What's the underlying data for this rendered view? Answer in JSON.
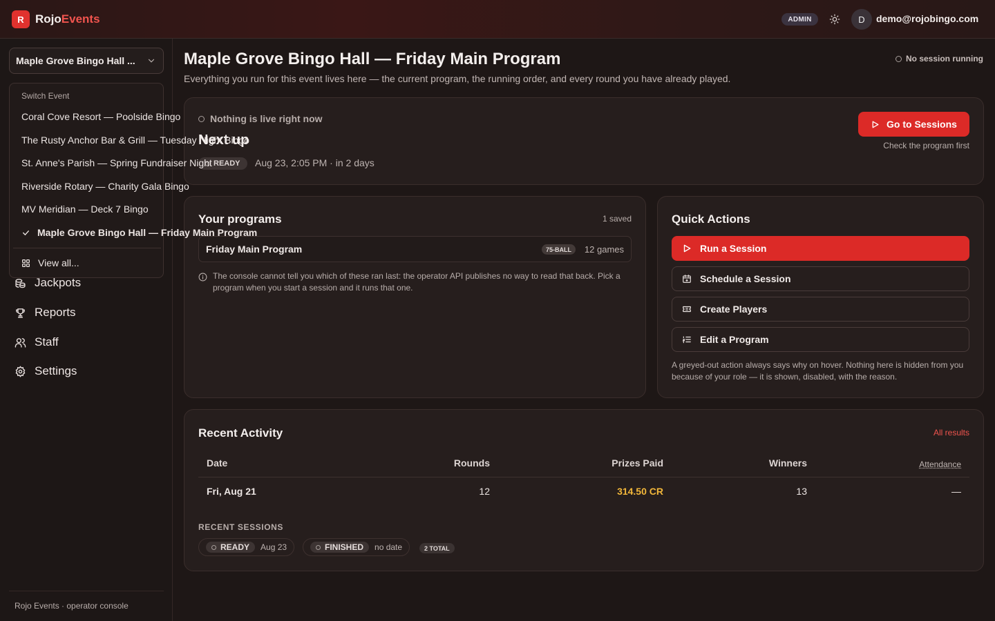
{
  "app": {
    "logo_letter": "R",
    "brand_part1": "Rojo",
    "brand_part2": "Events",
    "role_badge": "ADMIN",
    "user_initial": "D",
    "user_email": "demo@rojobingo.com"
  },
  "sidebar": {
    "selected_event": "Maple Grove Bingo Hall ...",
    "nav": [
      {
        "label": "Jackpots",
        "icon": "coins-icon"
      },
      {
        "label": "Reports",
        "icon": "trophy-icon"
      },
      {
        "label": "Staff",
        "icon": "users-icon"
      },
      {
        "label": "Settings",
        "icon": "gear-icon"
      }
    ],
    "footer": "Rojo Events · operator console"
  },
  "event_dropdown": {
    "header": "Switch Event",
    "items": [
      "Coral Cove Resort — Poolside Bingo",
      "The Rusty Anchor Bar & Grill — Tuesday Night Bingo",
      "St. Anne's Parish — Spring Fundraiser Night",
      "Riverside Rotary — Charity Gala Bingo",
      "MV Meridian — Deck 7 Bingo",
      "Maple Grove Bingo Hall — Friday Main Program"
    ],
    "view_all": "View all..."
  },
  "page": {
    "title": "Maple Grove Bingo Hall — Friday Main Program",
    "subtitle": "Everything you run for this event lives here — the current program, the running order, and every round you have already played.",
    "session_status": "No session running"
  },
  "next_up": {
    "live_status": "Nothing is live right now",
    "heading": "Next up",
    "status_pill": "READY",
    "when": "Aug 23, 2:05 PM · in 2 days",
    "button": "Go to Sessions",
    "hint": "Check the program first"
  },
  "programs": {
    "title": "Your programs",
    "saved_count": "1 saved",
    "items": [
      {
        "name": "Friday Main Program",
        "badge": "75-BALL",
        "games": "12 games"
      }
    ],
    "note": "The console cannot tell you which of these ran last: the operator API publishes no way to read that back. Pick a program when you start a session and it runs that one."
  },
  "quick_actions": {
    "title": "Quick Actions",
    "buttons": [
      "Run a Session",
      "Schedule a Session",
      "Create Players",
      "Edit a Program"
    ],
    "note": "A greyed-out action always says why on hover. Nothing here is hidden from you because of your role — it is shown, disabled, with the reason."
  },
  "activity": {
    "title": "Recent Activity",
    "all_results": "All results",
    "columns": [
      "Date",
      "Rounds",
      "Prizes Paid",
      "Winners",
      "Attendance"
    ],
    "rows": [
      {
        "date": "Fri, Aug 21",
        "rounds": "12",
        "prizes": "314.50 CR",
        "winners": "13",
        "attendance": "—"
      }
    ],
    "recent_sessions_label": "RECENT SESSIONS",
    "sessions": [
      {
        "status": "READY",
        "date": "Aug 23"
      },
      {
        "status": "FINISHED",
        "date": "no date"
      }
    ],
    "total_badge": "2 TOTAL"
  },
  "colors": {
    "accent": "#dc2a27",
    "brand_red": "#f0544e",
    "prize_gold": "#f2b73a",
    "background": "#1e1716"
  }
}
